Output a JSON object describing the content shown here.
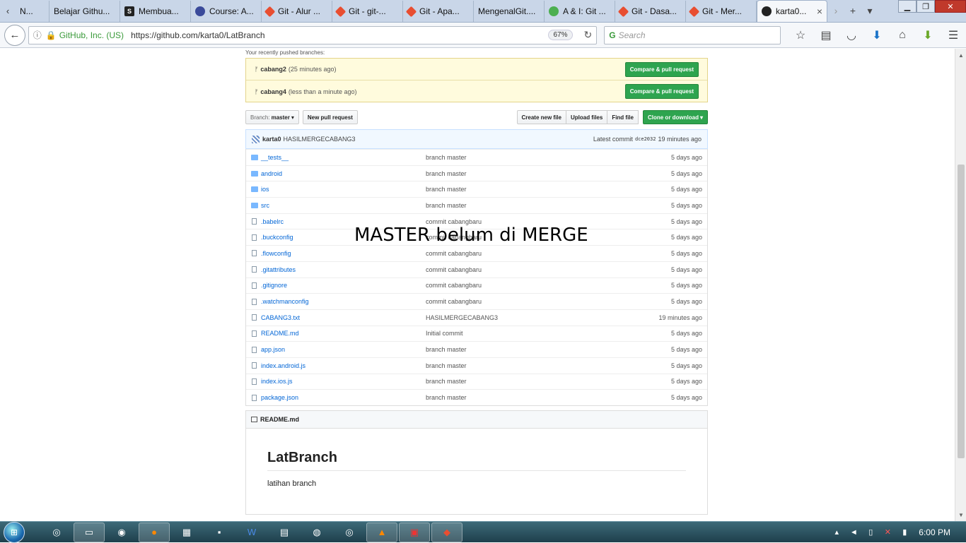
{
  "browser": {
    "tabs": [
      {
        "label": "N...",
        "icon": "leftcut"
      },
      {
        "label": "Belajar Githu...",
        "icon": "none"
      },
      {
        "label": "Membua...",
        "icon": "s-icon"
      },
      {
        "label": "Course: A...",
        "icon": "course-icon"
      },
      {
        "label": "Git - Alur ...",
        "icon": "git-icon"
      },
      {
        "label": "Git - git-...",
        "icon": "git-icon"
      },
      {
        "label": "Git - Apa...",
        "icon": "git-icon"
      },
      {
        "label": "MengenalGit....",
        "icon": "none"
      },
      {
        "label": "A & I: Git ...",
        "icon": "ai-icon"
      },
      {
        "label": "Git - Dasa...",
        "icon": "git-icon"
      },
      {
        "label": "Git - Mer...",
        "icon": "git-icon"
      }
    ],
    "active_tab": {
      "label": "karta0...",
      "close": "×"
    },
    "identity": "GitHub, Inc. (US)",
    "url": "https://github.com/karta0/LatBranch",
    "zoom": "67%",
    "search_placeholder": "Search"
  },
  "recent": {
    "label": "Your recently pushed branches:",
    "branches": [
      {
        "name": "cabang2",
        "when": "(25 minutes ago)",
        "button": "Compare & pull request"
      },
      {
        "name": "cabang4",
        "when": "(less than a minute ago)",
        "button": "Compare & pull request"
      }
    ]
  },
  "toolbar": {
    "branch_prefix": "Branch:",
    "branch": "master",
    "new_pr": "New pull request",
    "create_file": "Create new file",
    "upload": "Upload files",
    "find": "Find file",
    "clone": "Clone or download"
  },
  "commit": {
    "user": "karta0",
    "message": "HASILMERGECABANG3",
    "latest_label": "Latest commit",
    "sha": "dce2032",
    "age": "19 minutes ago"
  },
  "files": [
    {
      "name": "__tests__",
      "type": "dir",
      "msg": "branch master",
      "age": "5 days ago"
    },
    {
      "name": "android",
      "type": "dir",
      "msg": "branch master",
      "age": "5 days ago"
    },
    {
      "name": "ios",
      "type": "dir",
      "msg": "branch master",
      "age": "5 days ago"
    },
    {
      "name": "src",
      "type": "dir",
      "msg": "branch master",
      "age": "5 days ago"
    },
    {
      "name": ".babelrc",
      "type": "file",
      "msg": "commit cabangbaru",
      "age": "5 days ago"
    },
    {
      "name": ".buckconfig",
      "type": "file",
      "msg": "commit cabangbaru",
      "age": "5 days ago"
    },
    {
      "name": ".flowconfig",
      "type": "file",
      "msg": "commit cabangbaru",
      "age": "5 days ago"
    },
    {
      "name": ".gitattributes",
      "type": "file",
      "msg": "commit cabangbaru",
      "age": "5 days ago"
    },
    {
      "name": ".gitignore",
      "type": "file",
      "msg": "commit cabangbaru",
      "age": "5 days ago"
    },
    {
      "name": ".watchmanconfig",
      "type": "file",
      "msg": "commit cabangbaru",
      "age": "5 days ago"
    },
    {
      "name": "CABANG3.txt",
      "type": "file",
      "msg": "HASILMERGECABANG3",
      "age": "19 minutes ago"
    },
    {
      "name": "README.md",
      "type": "file",
      "msg": "Initial commit",
      "age": "5 days ago"
    },
    {
      "name": "app.json",
      "type": "file",
      "msg": "branch master",
      "age": "5 days ago"
    },
    {
      "name": "index.android.js",
      "type": "file",
      "msg": "branch master",
      "age": "5 days ago"
    },
    {
      "name": "index.ios.js",
      "type": "file",
      "msg": "branch master",
      "age": "5 days ago"
    },
    {
      "name": "package.json",
      "type": "file",
      "msg": "branch master",
      "age": "5 days ago"
    }
  ],
  "readme": {
    "filename": "README.md",
    "title": "LatBranch",
    "body": "latihan branch"
  },
  "overlay": "MASTER belum di MERGE",
  "taskbar": {
    "clock": "6:00 PM"
  },
  "colors": {
    "green": "#2ea44f",
    "link": "#0366d6",
    "highlight": "#fffbdd"
  }
}
